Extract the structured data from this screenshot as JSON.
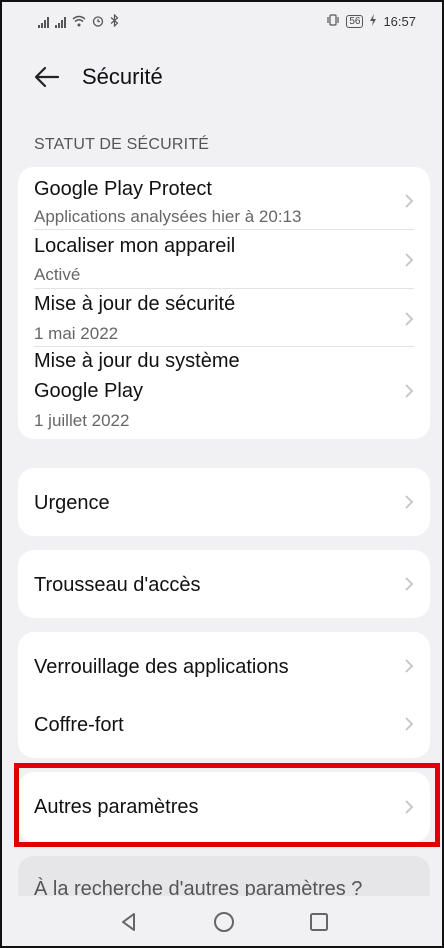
{
  "status_bar": {
    "time": "16:57",
    "battery": "56",
    "icons": [
      "signal-icon",
      "signal-icon",
      "wifi-icon",
      "alarm-icon",
      "bluetooth-icon",
      "vibrate-icon",
      "battery-icon",
      "charging-icon"
    ]
  },
  "header": {
    "title": "Sécurité"
  },
  "security_status": {
    "section_label": "STATUT DE SÉCURITÉ",
    "items": [
      {
        "title": "Google Play Protect",
        "subtitle": "Applications analysées hier à 20:13"
      },
      {
        "title": "Localiser mon appareil",
        "subtitle": "Activé"
      },
      {
        "title": "Mise à jour de sécurité",
        "subtitle": "1 mai 2022"
      },
      {
        "title_line1": "Mise à jour du système",
        "title_line2": "Google Play",
        "subtitle": "1 juillet 2022"
      }
    ]
  },
  "emergency": {
    "label": "Urgence"
  },
  "keychain": {
    "label": "Trousseau d'accès"
  },
  "app_lock_group": {
    "items": [
      {
        "label": "Verrouillage des applications"
      },
      {
        "label": "Coffre-fort"
      }
    ]
  },
  "more_settings": {
    "label": "Autres paramètres"
  },
  "search_hint": {
    "text": "À la recherche d'autres paramètres ?"
  },
  "colors": {
    "highlight": "#e00000",
    "background": "#f1f1f3",
    "card": "#ffffff"
  }
}
